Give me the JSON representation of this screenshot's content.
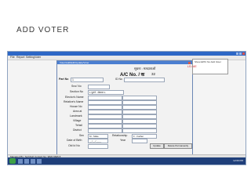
{
  "slide": {
    "title": "ADD VOTER"
  },
  "app": {
    "menu": [
      "File",
      "Report",
      "Setting",
      "Voter"
    ],
    "form_window_title": "Voter/Add/Edit/Update/Voter",
    "side_panel_text": "Show EPIC No Add Voter",
    "side_red_text": "LS / AE",
    "header_hindi": "सूचना : मतदाताओं",
    "header_ac": "A/C No. / क",
    "header_ac_value": "32",
    "part_no_label": "Part No",
    "part_no_value": "1",
    "id_no_label": "ID No",
    "fields": {
      "sno": "Sno/ No",
      "section": "Section No",
      "section_value": "1 पुराने - सेक्शन 1",
      "elector_name": "Elector's Name",
      "relative_name": "Relative's Name",
      "house_no": "House No",
      "area": "Area at",
      "landmark": "Landmark",
      "village": "Village",
      "tehsil": "Tehsil",
      "district": "District",
      "sex": "Sex",
      "sex_value": "M - Male",
      "relationship": "Relationship",
      "relationship_value": "F - Father",
      "dob": "Date of Birth",
      "dob_value": "__/__/____",
      "year": "Year",
      "old_id": "Old Id No"
    },
    "buttons": {
      "update": "Update",
      "delete": "Delete Permanently"
    },
    "status_text": "Managed By: TechSoft Contact No: 9820 9845 8",
    "clock": "12:09 PM"
  }
}
